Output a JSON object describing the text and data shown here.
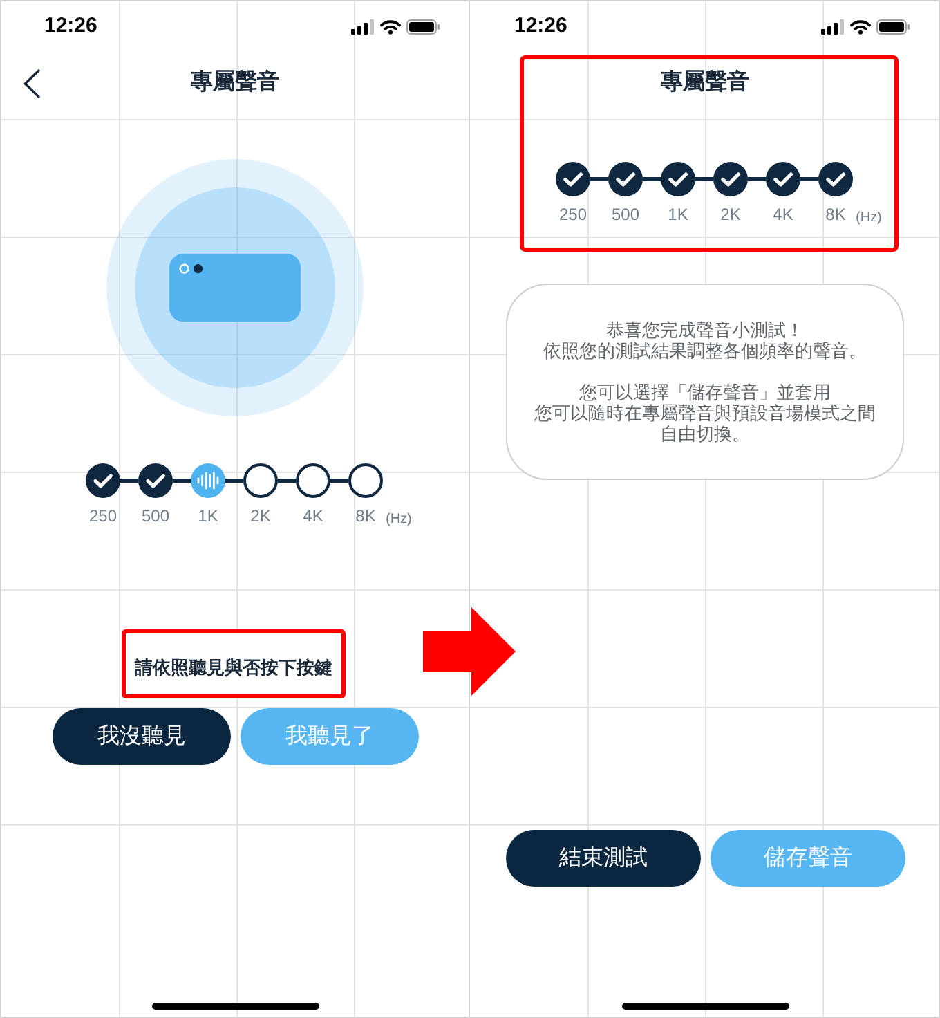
{
  "screens": [
    {
      "kind": "test",
      "status_bar": {
        "time": "12:26"
      },
      "header": {
        "title": "專屬聲音",
        "back_button": true
      },
      "steps": [
        {
          "label": "250",
          "checked": true,
          "selected": false
        },
        {
          "label": "500",
          "checked": true,
          "selected": false
        },
        {
          "label": "1K",
          "checked": false,
          "selected": true
        },
        {
          "label": "2K",
          "checked": false,
          "selected": false
        },
        {
          "label": "4K",
          "checked": false,
          "selected": false
        },
        {
          "label": "8K",
          "checked": false,
          "selected": false
        }
      ],
      "unit": "(Hz)",
      "instruction": {
        "text": "請依照聽見與否按下按鍵",
        "highlighted": true
      },
      "buttons": [
        {
          "label": "我沒聽見",
          "kind": "secondary"
        },
        {
          "label": "我聽見了",
          "kind": "primary"
        }
      ]
    },
    {
      "kind": "result",
      "status_bar": {
        "time": "12:26"
      },
      "header": {
        "title": "專屬聲音",
        "back_button": false
      },
      "summary_highlighted": true,
      "steps": [
        {
          "label": "250",
          "checked": true,
          "selected": false
        },
        {
          "label": "500",
          "checked": true,
          "selected": false
        },
        {
          "label": "1K",
          "checked": true,
          "selected": false
        },
        {
          "label": "2K",
          "checked": true,
          "selected": false
        },
        {
          "label": "4K",
          "checked": true,
          "selected": false
        },
        {
          "label": "8K",
          "checked": true,
          "selected": false
        }
      ],
      "unit": "(Hz)",
      "message": [
        [
          "恭喜您完成聲音小測試！",
          "依照您的測試結果調整各個頻率的聲音。"
        ],
        [
          "您可以選擇「儲存聲音」並套用",
          "您可以隨時在專屬聲音與預設音場模式之間",
          "自由切換。"
        ]
      ],
      "buttons": [
        {
          "label": "結束測試",
          "kind": "secondary"
        },
        {
          "label": "儲存聲音",
          "kind": "primary"
        }
      ]
    }
  ]
}
